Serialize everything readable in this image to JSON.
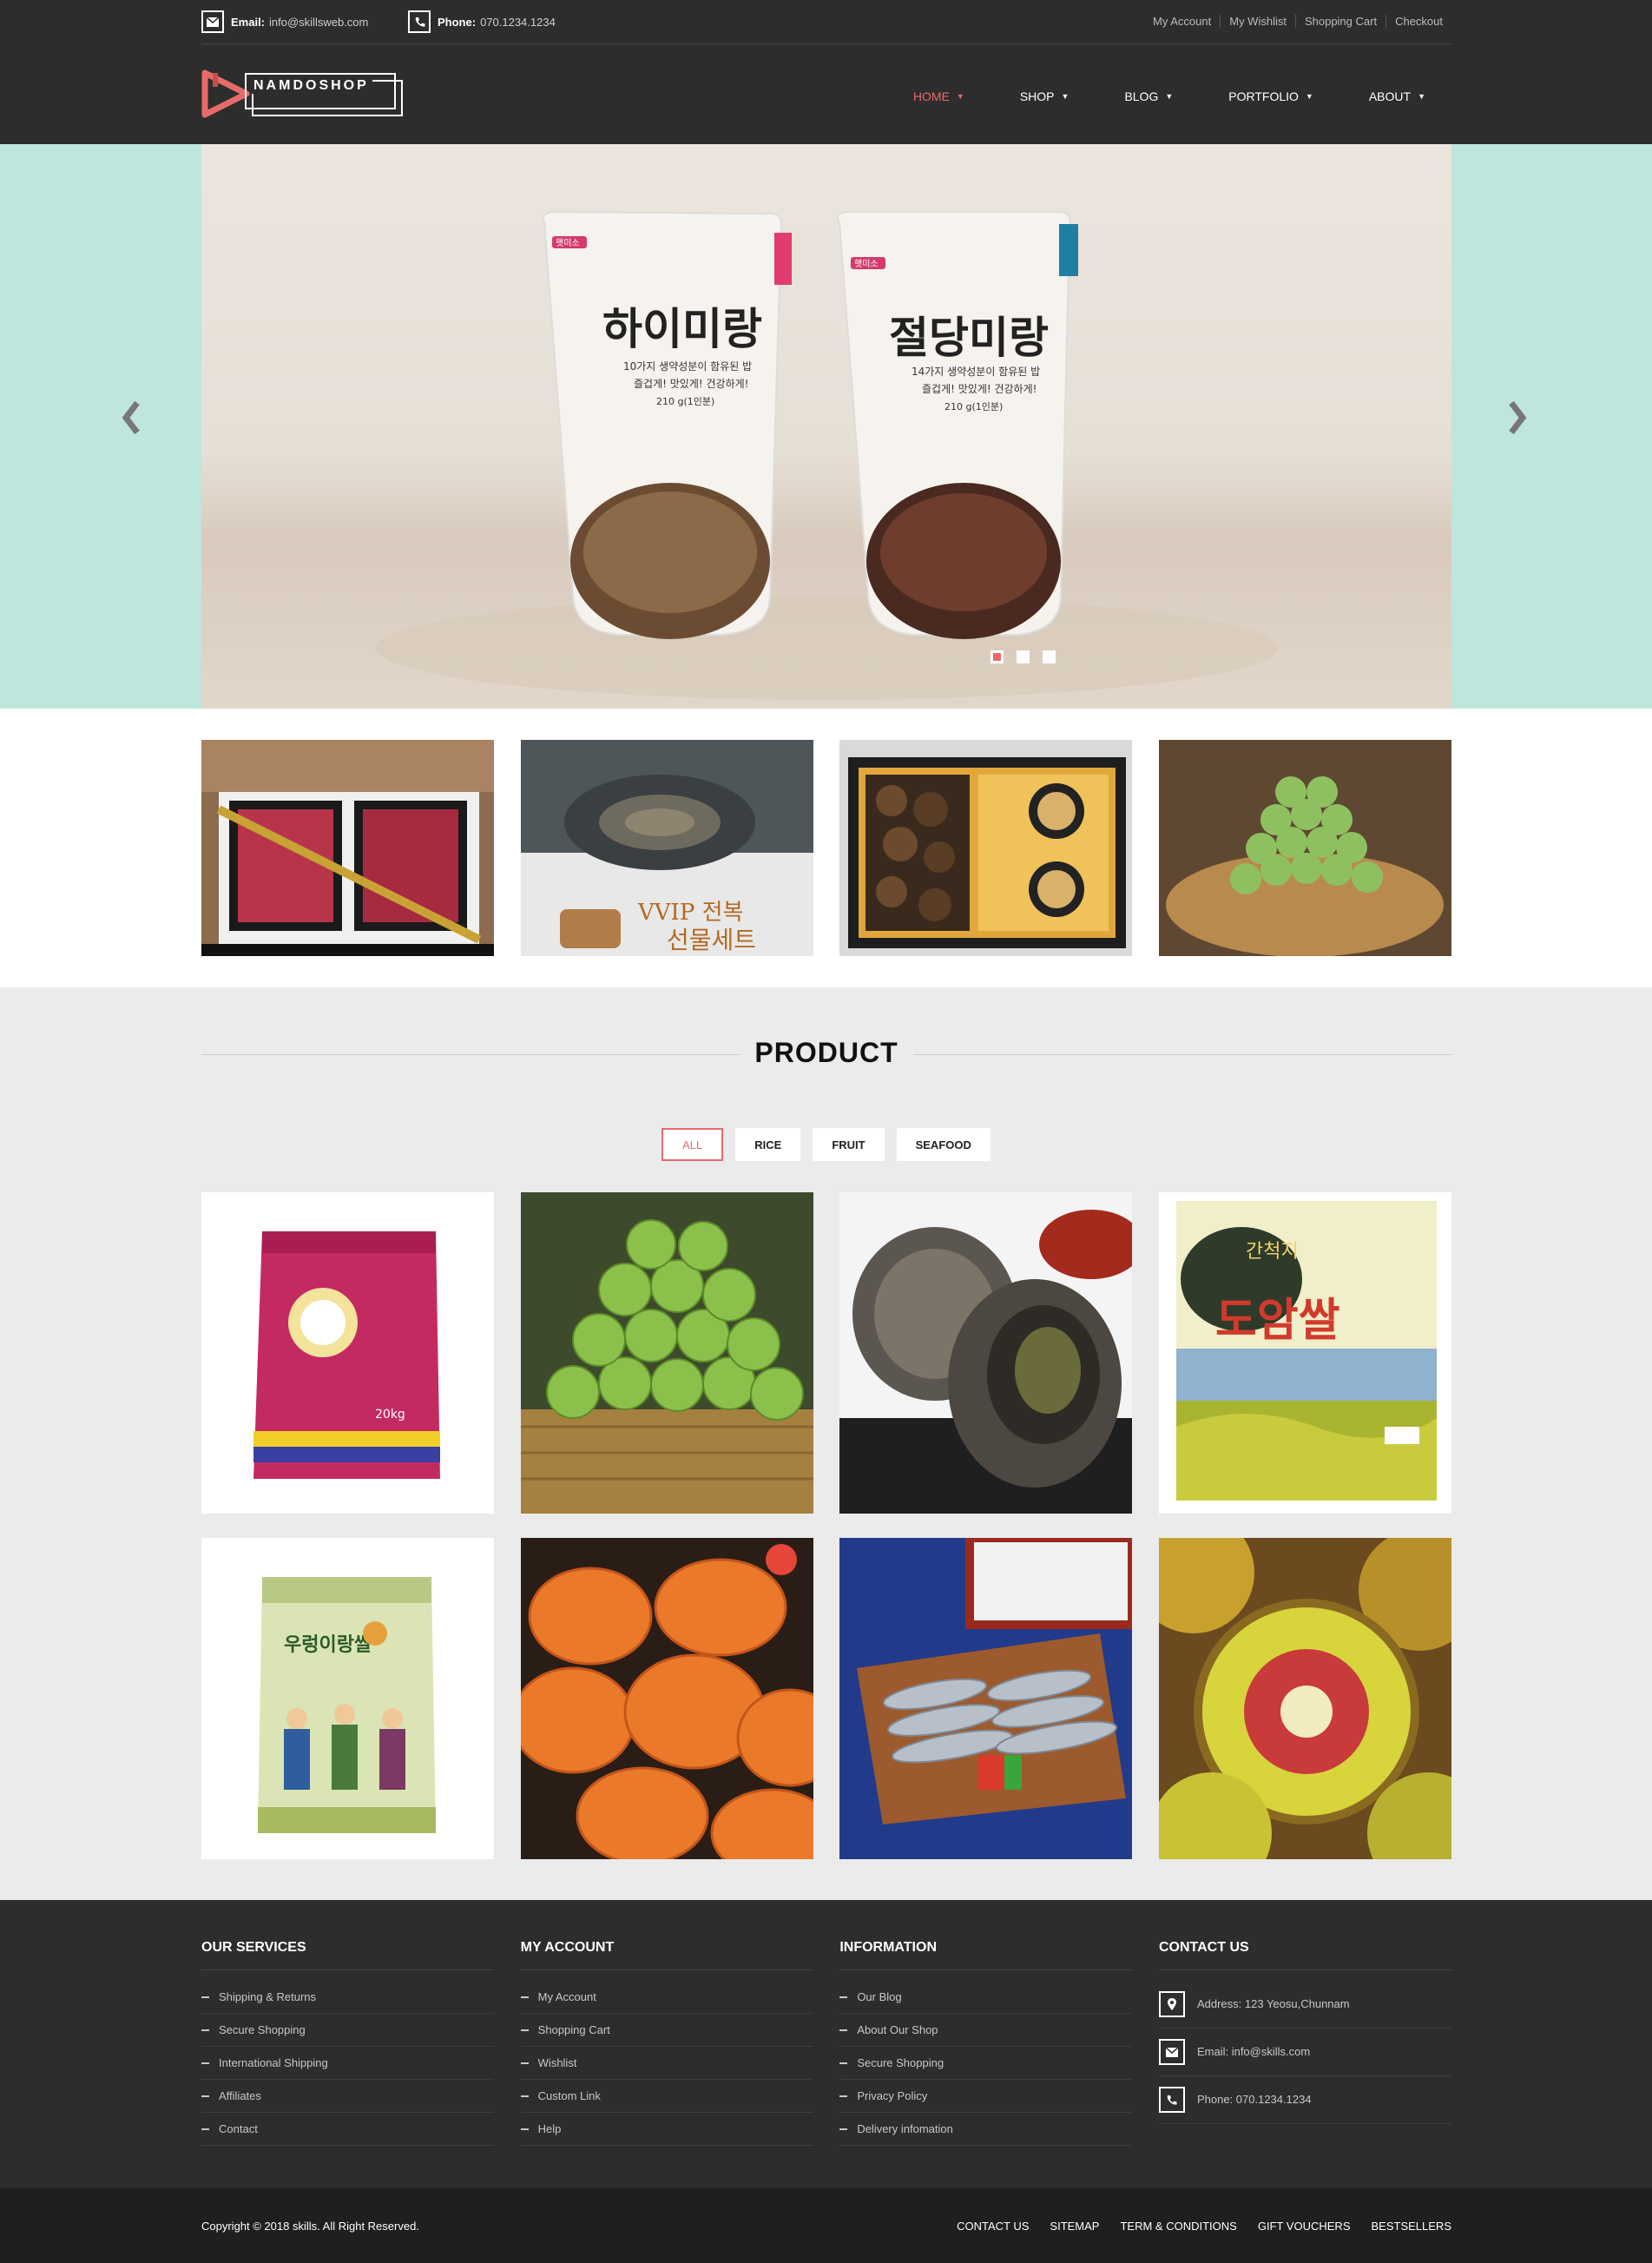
{
  "topbar": {
    "email_label": "Email:",
    "email_value": "info@skillsweb.com",
    "phone_label": "Phone:",
    "phone_value": "070.1234.1234",
    "links": [
      "My Account",
      "My Wishlist",
      "Shopping Cart",
      "Checkout"
    ]
  },
  "logo": {
    "text": "NAMDOSHOP"
  },
  "nav": {
    "items": [
      "HOME",
      "SHOP",
      "BLOG",
      "PORTFOLIO",
      "ABOUT"
    ],
    "active": "HOME"
  },
  "hero": {
    "slide_count": 3,
    "active_slide": 1,
    "bags": [
      {
        "brand": "햇미소",
        "name": "하이미랑",
        "sub": "10가지 생약성분이 함유된 밥",
        "slogan": "즐겁게! 맛있게! 건강하게!",
        "weight": "210 g(1인분)"
      },
      {
        "brand": "햇미소",
        "name": "절당미랑",
        "sub": "14가지 생약성분이 함유된 밥",
        "slogan": "즐겁게! 맛있게! 건강하게!",
        "weight": "210 g(1인분)"
      }
    ]
  },
  "promos": [
    {
      "name": "beef-gift-set"
    },
    {
      "name": "abalone-gift-set",
      "caption_1": "VVIP 전복",
      "caption_2": "선물세트"
    },
    {
      "name": "mushroom-gift-set"
    },
    {
      "name": "green-plums"
    }
  ],
  "products": {
    "title": "PRODUCT",
    "filters": [
      "ALL",
      "RICE",
      "FRUIT",
      "SEAFOOD"
    ],
    "active_filter": "ALL",
    "items": [
      {
        "name": "rice-bag-red",
        "label": "20kg"
      },
      {
        "name": "green-plums"
      },
      {
        "name": "abalone"
      },
      {
        "name": "rice-bag-doam",
        "label": "도암쌀",
        "top": "간척지"
      },
      {
        "name": "rice-bag-green",
        "label": "우렁이랑쌀"
      },
      {
        "name": "dried-persimmon"
      },
      {
        "name": "fish-platter"
      },
      {
        "name": "red-kiwi"
      }
    ]
  },
  "footer": {
    "services": {
      "title": "OUR SERVICES",
      "items": [
        "Shipping & Returns",
        "Secure Shopping",
        "International Shipping",
        "Affiliates",
        "Contact"
      ]
    },
    "account": {
      "title": "MY ACCOUNT",
      "items": [
        "My Account",
        "Shopping Cart",
        "Wishlist",
        "Custom Link",
        "Help"
      ]
    },
    "information": {
      "title": "INFORMATION",
      "items": [
        "Our Blog",
        "About Our Shop",
        "Secure Shopping",
        "Privacy Policy",
        "Delivery infomation"
      ]
    },
    "contact": {
      "title": "CONTACT US",
      "address": "Address: 123 Yeosu,Chunnam",
      "email": "Email: info@skills.com",
      "phone": "Phone: 070.1234.1234"
    }
  },
  "bottom": {
    "copyright": "Copyright © 2018 skills. All Right Reserved.",
    "links": [
      "CONTACT US",
      "SITEMAP",
      "TERM & CONDITIONS",
      "GIFT VOUCHERS",
      "BESTSELLERS"
    ]
  },
  "colors": {
    "accent": "#e96a6a",
    "header_bg": "#2d2d2d",
    "hero_bg": "#bfe6dc",
    "section_bg": "#ebebeb",
    "footer_bg": "#2d2d2d"
  }
}
